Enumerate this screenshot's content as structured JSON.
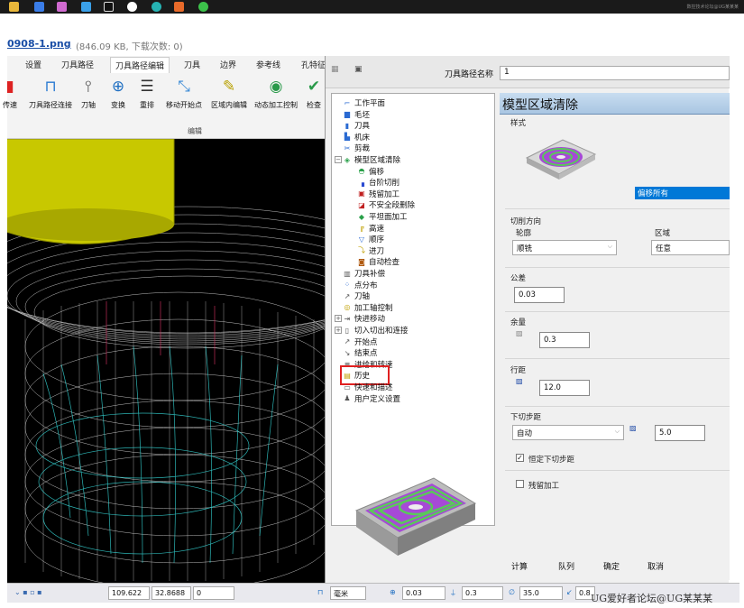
{
  "taskbar": {
    "icons": [
      "folder-icon",
      "shield-icon",
      "brush-icon",
      "mail-icon",
      "tiktok-icon",
      "media-icon",
      "edge-icon",
      "powerpoint-icon",
      "wechat-icon"
    ],
    "note": "数控技术论坛@UG某某某"
  },
  "file": {
    "name": "0908-1.png",
    "meta": "(846.09 KB, 下载次数: 0)"
  },
  "ribbon": {
    "tabs": [
      "设置",
      "刀具路径",
      "刀具路径编辑",
      "刀具",
      "边界",
      "参考线",
      "孔特征"
    ],
    "active_tab": "刀具路径编辑",
    "buttons": [
      {
        "label": "传速",
        "icon": "speed-icon"
      },
      {
        "label": "刀具路径连接",
        "icon": "link-icon"
      },
      {
        "label": "刀轴",
        "icon": "tool-axis-icon"
      },
      {
        "label": "变换",
        "icon": "transform-icon"
      },
      {
        "label": "重排",
        "icon": "reorder-icon"
      },
      {
        "label": "移动开始点",
        "icon": "move-start-icon"
      },
      {
        "label": "区域内编辑",
        "icon": "region-edit-icon"
      },
      {
        "label": "动态加工控制",
        "icon": "dynamic-control-icon"
      },
      {
        "label": "检查",
        "icon": "check-icon"
      }
    ],
    "group_label": "编辑"
  },
  "statusbar": {
    "x": "109.622",
    "y": "32.8688",
    "z": "0",
    "unit": "毫米",
    "tol": "0.03",
    "thk": "0.3",
    "angle": "35.0",
    "step": "0.8"
  },
  "dialog": {
    "name_label": "刀具路径名称",
    "name_value": "1",
    "tree": [
      {
        "label": "工作平面",
        "icon": "workplane-icon",
        "level": 0
      },
      {
        "label": "毛坯",
        "icon": "block-icon",
        "level": 0
      },
      {
        "label": "刀具",
        "icon": "tool-icon",
        "level": 0
      },
      {
        "label": "机床",
        "icon": "machine-icon",
        "level": 0
      },
      {
        "label": "剪裁",
        "icon": "trim-icon",
        "level": 0
      },
      {
        "label": "模型区域清除",
        "icon": "model-area-clear-icon",
        "level": 0,
        "expanded": true
      },
      {
        "label": "偏移",
        "icon": "offset-icon",
        "level": 1
      },
      {
        "label": "台阶切削",
        "icon": "step-cut-icon",
        "level": 1
      },
      {
        "label": "残留加工",
        "icon": "rest-machining-icon",
        "level": 1
      },
      {
        "label": "不安全段删除",
        "icon": "unsafe-delete-icon",
        "level": 1
      },
      {
        "label": "平坦面加工",
        "icon": "flat-face-icon",
        "level": 1
      },
      {
        "label": "高速",
        "icon": "high-speed-icon",
        "level": 1
      },
      {
        "label": "顺序",
        "icon": "order-icon",
        "level": 1
      },
      {
        "label": "进刀",
        "icon": "lead-in-icon",
        "level": 1
      },
      {
        "label": "自动检查",
        "icon": "auto-check-icon",
        "level": 1
      },
      {
        "label": "刀具补偿",
        "icon": "tool-comp-icon",
        "level": 0
      },
      {
        "label": "点分布",
        "icon": "point-dist-icon",
        "level": 0
      },
      {
        "label": "刀轴",
        "icon": "axis-icon",
        "level": 0
      },
      {
        "label": "加工轴控制",
        "icon": "axis-control-icon",
        "level": 0
      },
      {
        "label": "快进移动",
        "icon": "rapid-move-icon",
        "level": 0,
        "expandable": true
      },
      {
        "label": "切入切出和连接",
        "icon": "leads-links-icon",
        "level": 0,
        "expandable": true
      },
      {
        "label": "开始点",
        "icon": "start-point-icon",
        "level": 0
      },
      {
        "label": "结束点",
        "icon": "end-point-icon",
        "level": 0
      },
      {
        "label": "进给和转速",
        "icon": "feed-speed-icon",
        "level": 0
      },
      {
        "label": "历史",
        "icon": "history-icon",
        "level": 0,
        "highlighted": true
      },
      {
        "label": "快速和描述",
        "icon": "notes-icon",
        "level": 0
      },
      {
        "label": "用户定义设置",
        "icon": "user-settings-icon",
        "level": 0
      }
    ],
    "panel": {
      "title": "模型区域清除",
      "style_label": "样式",
      "style_value": "偏移所有",
      "cut_dir_label": "切削方向",
      "contour_label": "轮廓",
      "contour_value": "顺铣",
      "area_label": "区域",
      "area_value": "任意",
      "tolerance_label": "公差",
      "tolerance_value": "0.03",
      "allowance_label": "余量",
      "allowance_value": "0.3",
      "stepover_label": "行距",
      "stepover_value": "12.0",
      "stepdown_label": "下切步距",
      "stepdown_mode": "自动",
      "stepdown_value": "5.0",
      "const_stepdown_label": "恒定下切步距",
      "const_stepdown_checked": true,
      "rest_label": "残留加工",
      "rest_checked": false,
      "buttons": [
        "计算",
        "队列",
        "确定",
        "取消"
      ]
    }
  },
  "watermark": "UG爱好者论坛@UG某某某",
  "colors": {
    "accent": "#0078d7",
    "highlight": "#e02020",
    "tool": "#c8c800",
    "path_cyan": "#38e0e0"
  }
}
